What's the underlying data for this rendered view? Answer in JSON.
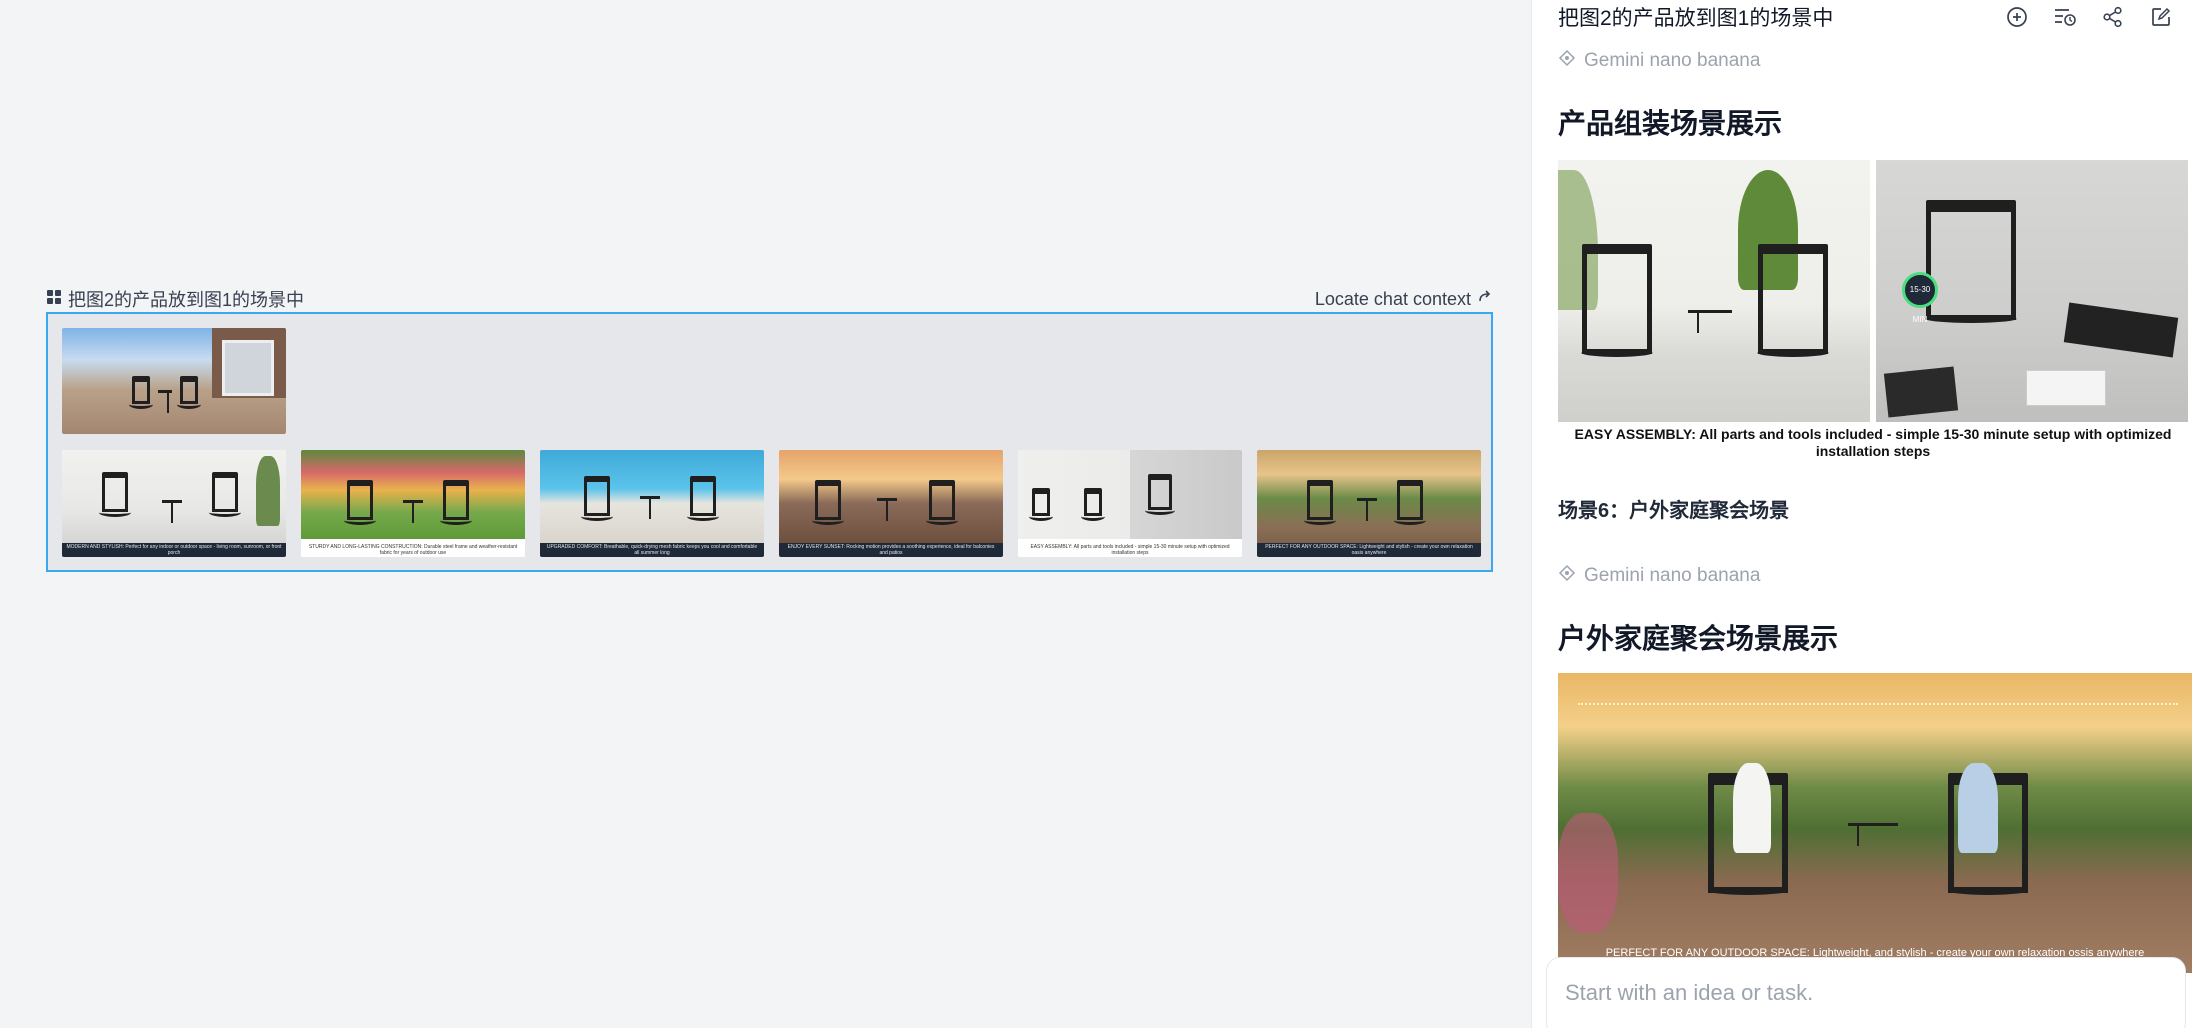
{
  "canvas": {
    "board_title": "把图2的产品放到图1的场景中",
    "locate_label": "Locate chat context",
    "thumbnails": [
      {
        "caption": ""
      },
      {
        "caption": "MODERN AND STYLISH: Perfect for any indoor or outdoor space - living room, sunroom, or front porch"
      },
      {
        "caption": "STURDY AND LONG-LASTING CONSTRUCTION: Durable steel frame and weather-resistant fabric for years of outdoor use"
      },
      {
        "caption": "UPGRADED COMFORT: Breathable, quick-drying mesh fabric keeps you cool and comfortable all summer long"
      },
      {
        "caption": "ENJOY EVERY SUNSET: Rocking motion provides a soothing experience, ideal for balconies and patios"
      },
      {
        "caption": "EASY ASSEMBLY: All parts and tools included - simple 15-30 minute setup with optimized installation steps"
      },
      {
        "caption": "PERFECT FOR ANY OUTDOOR SPACE: Lightweight and stylish - create your own relaxation oasis anywhere"
      }
    ]
  },
  "panel": {
    "title": "把图2的产品放到图1的场景中",
    "gemini_label": "Gemini nano banana",
    "section1_heading": "产品组装场景展示",
    "section1_caption": "EASY ASSEMBLY: All parts and tools included - simple 15-30 minute setup with optimized installation steps",
    "badge_text": "15-30 MIN",
    "scene6_title": "场景6：户外家庭聚会场景",
    "gemini_label_2": "Gemini nano banana",
    "section2_heading": "户外家庭聚会场景展示",
    "section2_overlay": "PERFECT FOR ANY OUTDOOR SPACE: Lightweight,  and stylish - create your  own relaxation ossis anywhere",
    "input_placeholder": "Start with an idea or task."
  },
  "icons": [
    "new-chat-icon",
    "history-icon",
    "share-icon",
    "edit-icon",
    "board-icon",
    "arrow-out-icon",
    "gemini-icon"
  ],
  "colors": {
    "accent_border": "#38a9f0",
    "canvas_bg": "#f3f4f6",
    "board_bg": "#e6e7eb"
  }
}
